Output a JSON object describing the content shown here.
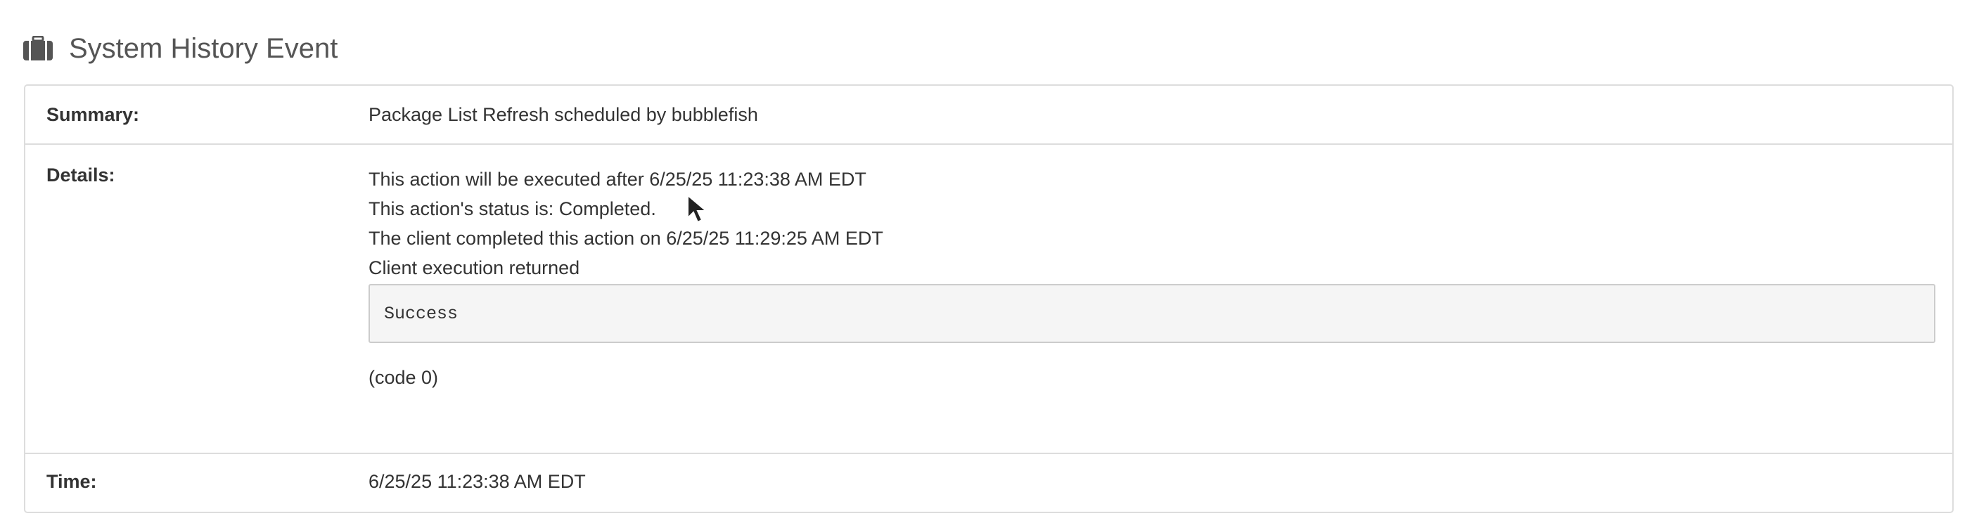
{
  "header": {
    "icon": "briefcase-icon",
    "title": "System History Event"
  },
  "event": {
    "summary_label": "Summary:",
    "summary_value": "Package List Refresh scheduled by bubblefish",
    "details_label": "Details:",
    "details_lines": [
      "This action will be executed after 6/25/25 11:23:38 AM EDT",
      "This action's status is: Completed.",
      "The client completed this action on 6/25/25 11:29:25 AM EDT",
      "Client execution returned"
    ],
    "execution_output": "Success",
    "return_code": "(code 0)",
    "time_label": "Time:",
    "time_value": "6/25/25 11:23:38 AM EDT"
  },
  "colors": {
    "border": "#dddddd",
    "text": "#333333",
    "title": "#555555",
    "code_background": "#f5f5f5"
  }
}
